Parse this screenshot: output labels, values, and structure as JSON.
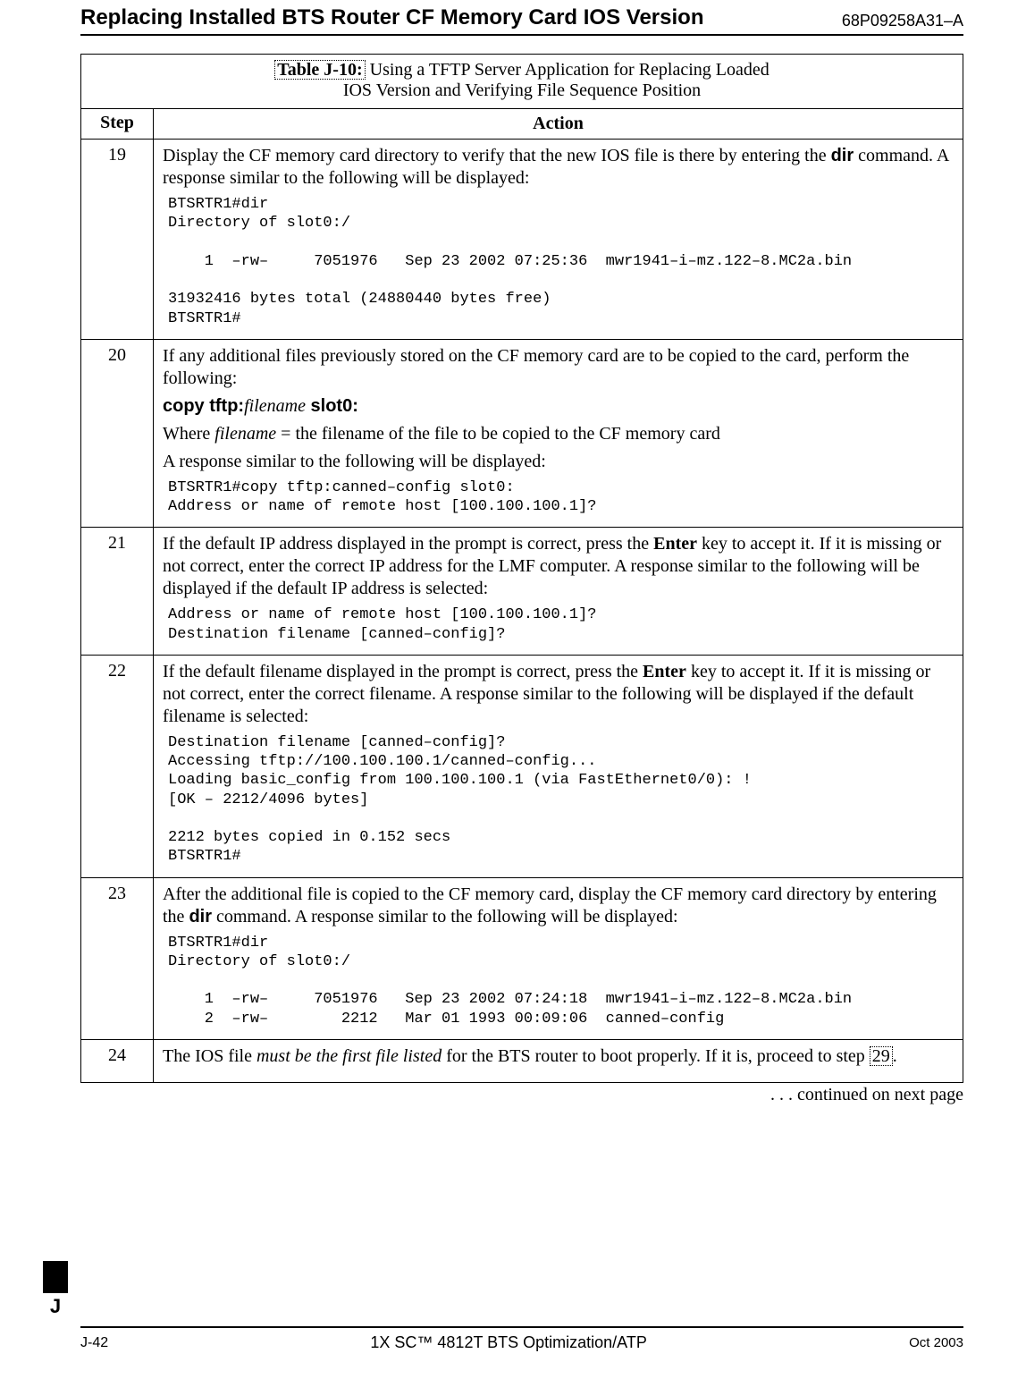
{
  "header": {
    "title": "Replacing Installed BTS Router CF Memory Card IOS Version",
    "doc_code": "68P09258A31–A"
  },
  "table": {
    "title_strong": "Table J-10:",
    "title_rest_line1": " Using a TFTP Server Application for Replacing Loaded",
    "title_line2": "IOS Version and Verifying File Sequence Position",
    "col_step": "Step",
    "col_action": "Action"
  },
  "rows": {
    "r19": {
      "step": "19",
      "p1a": "Display the CF memory card directory to verify that the new IOS file is there by entering the ",
      "dir": "dir",
      "p1b": " command.  A response similar to the following will be displayed:",
      "code": "BTSRTR1#dir\nDirectory of slot0:/\n\n    1  –rw–     7051976   Sep 23 2002 07:25:36  mwr1941–i–mz.122–8.MC2a.bin\n\n31932416 bytes total (24880440 bytes free)\nBTSRTR1#"
    },
    "r20": {
      "step": "20",
      "p1": "If any additional files previously stored on the CF memory card are to be copied to the card, perform the following:",
      "cmd_copy": "copy  tftp:",
      "cmd_filename": "filename",
      "cmd_slot": "  slot0:",
      "p2a": "Where ",
      "p2b": "filename",
      "p2c": "  =  the filename of the file to be copied to the CF memory card",
      "p3": "A response similar to the following will be displayed:",
      "code": "BTSRTR1#copy tftp:canned–config slot0:\nAddress or name of remote host [100.100.100.1]?"
    },
    "r21": {
      "step": "21",
      "p1a": "If the default IP address displayed in the prompt is correct, press the ",
      "enter": "Enter",
      "p1b": " key to accept it. If it is missing or not correct, enter the correct IP address for the LMF computer. A response similar to the following will be displayed if the default IP address is selected:",
      "code": "Address or name of remote host [100.100.100.1]?\nDestination filename [canned–config]?"
    },
    "r22": {
      "step": "22",
      "p1a": "If the default filename displayed in the prompt is correct, press the ",
      "enter": "Enter",
      "p1b": " key to accept it. If it is missing or not correct, enter the correct filename. A response similar to the following will be displayed if the default filename is selected:",
      "code": "Destination filename [canned–config]?\nAccessing tftp://100.100.100.1/canned–config...\nLoading basic_config from 100.100.100.1 (via FastEthernet0/0): !\n[OK – 2212/4096 bytes]\n\n2212 bytes copied in 0.152 secs\nBTSRTR1#"
    },
    "r23": {
      "step": "23",
      "p1a": "After the additional file is copied to the CF memory card, display the CF memory card directory by entering the ",
      "dir": "dir",
      "p1b": " command.  A response similar to the following will be displayed:",
      "code": "BTSRTR1#dir\nDirectory of slot0:/\n\n    1  –rw–     7051976   Sep 23 2002 07:24:18  mwr1941–i–mz.122–8.MC2a.bin\n    2  –rw–        2212   Mar 01 1993 00:09:06  canned–config"
    },
    "r24": {
      "step": "24",
      "p1a": "The IOS file ",
      "p1b": "must be the first file listed",
      "p1c": " for the BTS router to boot properly. If it is, proceed to step ",
      "link": "29",
      "p1d": "."
    }
  },
  "continued": " . . . continued on next page",
  "side_tab": "J",
  "footer": {
    "left": "J-42",
    "center": "1X SC™ 4812T BTS Optimization/ATP",
    "right": "Oct 2003"
  }
}
